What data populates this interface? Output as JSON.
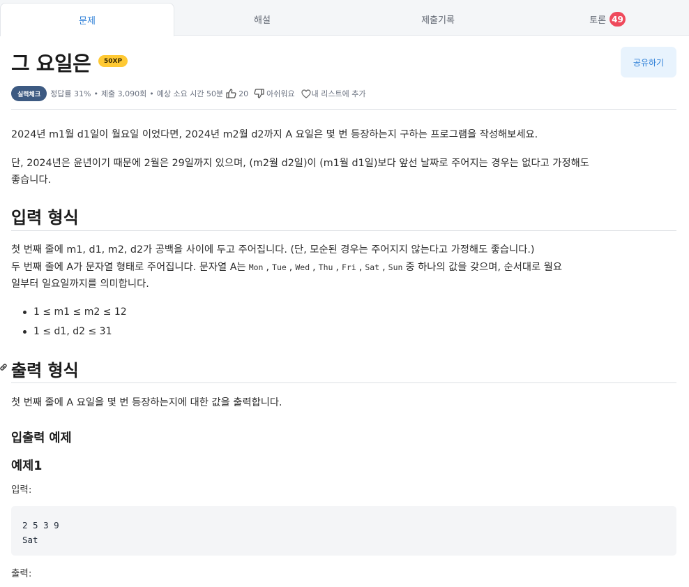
{
  "tabs": [
    {
      "label": "문제"
    },
    {
      "label": "해설"
    },
    {
      "label": "제출기록"
    },
    {
      "label": "토론",
      "count": "49"
    }
  ],
  "problem": {
    "title": "그 요일은",
    "xp": "50XP",
    "share_label": "공유하기",
    "meta": {
      "badge": "실력체크",
      "accuracy": "정답률 31%",
      "submissions": "제출 3,090회",
      "time": "예상 소요 시간 50분",
      "likes": "20",
      "dislike_label": "아쉬워요",
      "list_label": "내 리스트에 추가"
    },
    "description": [
      "2024년 m1월 d1일이 월요일 이었다면, 2024년 m2월 d2까지 A 요일은 몇 번 등장하는지 구하는 프로그램을 작성해보세요.",
      "단, 2024년은 윤년이기 때문에 2월은 29일까지 있으며, (m2월 d2일)이 (m1월 d1일)보다 앞선 날짜로 주어지는 경우는 없다고 가정해도",
      "좋습니다."
    ],
    "input_section": {
      "heading": "입력 형식",
      "line1": "첫 번째 줄에 m1, d1, m2, d2가 공백을 사이에 두고 주어집니다. (단, 모순된 경우는 주어지지 않는다고 가정해도 좋습니다.)",
      "line2_prefix": "두 번째 줄에 A가 문자열 형태로 주어집니다. 문자열 A는",
      "days": [
        "Mon",
        "Tue",
        "Wed",
        "Thu",
        "Fri",
        "Sat",
        "Sun"
      ],
      "line2_suffix": "중 하나의 값을 갖으며, 순서대로 월요",
      "line3": "일부터 일요일까지를 의미합니다.",
      "constraints": [
        "1 ≤ m1 ≤ m2 ≤ 12",
        "1 ≤ d1, d2 ≤ 31"
      ]
    },
    "output_section": {
      "heading": "출력 형식",
      "line1": "첫 번째 줄에 A 요일을 몇 번 등장하는지에 대한 값을 출력합니다."
    },
    "examples": {
      "heading": "입출력 예제",
      "example_title": "예제1",
      "input_label": "입력:",
      "input_code": "2 5 3 9\nSat",
      "output_label": "출력:"
    }
  },
  "colors": {
    "accent": "#2f80d8",
    "badge": "#3d5a82",
    "xp": "#ffc933",
    "count": "#ef4a5c"
  }
}
